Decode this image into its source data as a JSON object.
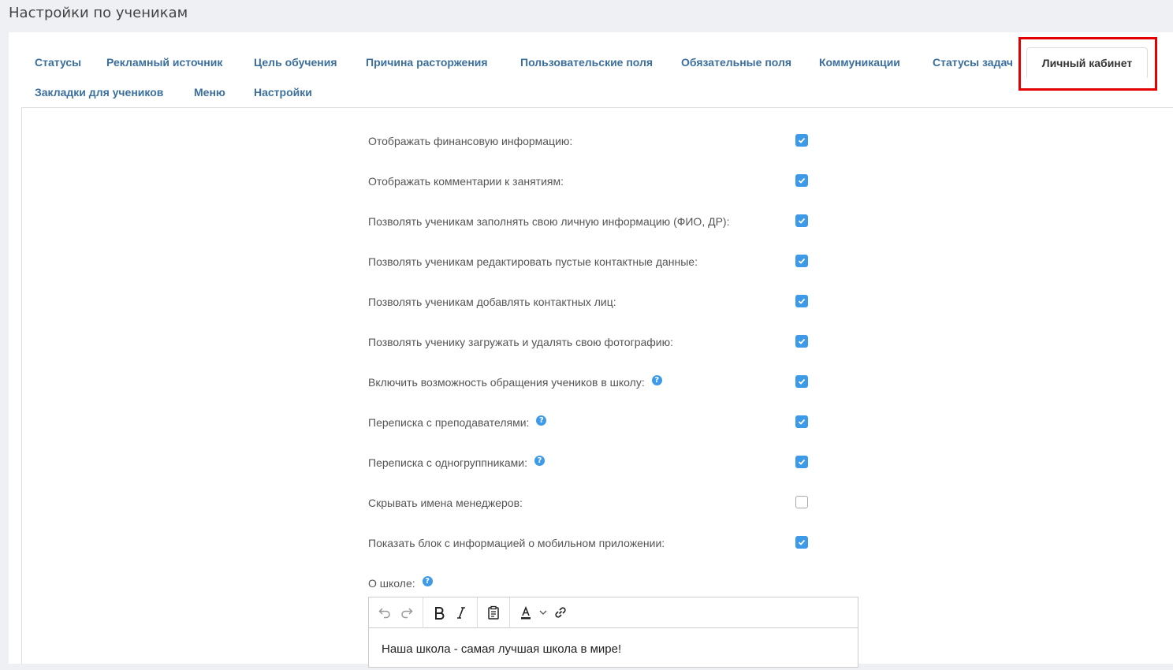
{
  "page": {
    "title": "Настройки по ученикам"
  },
  "tabs": {
    "row1": [
      "Статусы",
      "Рекламный источник",
      "Цель обучения",
      "Причина расторжения",
      "Пользовательские поля",
      "Обязательные поля",
      "Коммуникации",
      "Статусы задач"
    ],
    "active": "Личный кабинет",
    "row2": [
      "Закладки для учеников",
      "Меню",
      "Настройки"
    ]
  },
  "settings": [
    {
      "label": "Отображать финансовую информацию:",
      "checked": true,
      "help": false
    },
    {
      "label": "Отображать комментарии к занятиям:",
      "checked": true,
      "help": false
    },
    {
      "label": "Позволять ученикам заполнять свою личную информацию (ФИО, ДР):",
      "checked": true,
      "help": false
    },
    {
      "label": "Позволять ученикам редактировать пустые контактные данные:",
      "checked": true,
      "help": false
    },
    {
      "label": "Позволять ученикам добавлять контактных лиц:",
      "checked": true,
      "help": false
    },
    {
      "label": "Позволять ученику загружать и удалять свою фотографию:",
      "checked": true,
      "help": false
    },
    {
      "label": "Включить возможность обращения учеников в школу:",
      "checked": true,
      "help": true
    },
    {
      "label": "Переписка с преподавателями:",
      "checked": true,
      "help": true
    },
    {
      "label": "Переписка с одногруппниками:",
      "checked": true,
      "help": true
    },
    {
      "label": "Скрывать имена менеджеров:",
      "checked": false,
      "help": false
    },
    {
      "label": "Показать блок с информацией о мобильном приложении:",
      "checked": true,
      "help": false
    }
  ],
  "about": {
    "label": "О школе:",
    "content": "Наша школа - самая лучшая школа в мире!",
    "toolbar": [
      "undo-icon",
      "redo-icon",
      "bold-icon",
      "italic-icon",
      "paste-icon",
      "text-color-icon",
      "chevron-down-icon",
      "link-icon"
    ]
  },
  "help_glyph": "?",
  "colors": {
    "tab_link": "#3b6f9e",
    "checkbox": "#3d9ae8",
    "highlight": "#e30000"
  }
}
